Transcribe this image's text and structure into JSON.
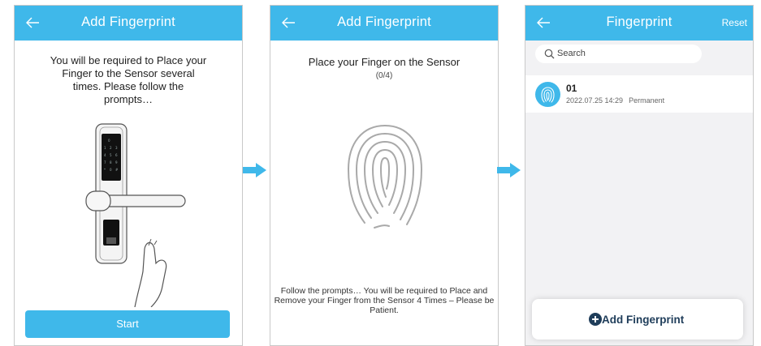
{
  "colors": {
    "accent": "#3fb8ea",
    "header_text": "#ffffff",
    "list_bg": "#f2f2f4",
    "add_label": "#1f3d5a"
  },
  "screen1": {
    "header_title": "Add Fingerprint",
    "back_icon": "arrow-left-icon",
    "instructions": "You will be required to Place your Finger to the Sensor several times. Please follow the prompts…",
    "image": "door-lock-with-finger-illustration",
    "start_label": "Start"
  },
  "screen2": {
    "header_title": "Add Fingerprint",
    "back_icon": "arrow-left-icon",
    "prompt": "Place your Finger on the Sensor",
    "progress": "(0/4)",
    "image": "fingerprint-icon",
    "footer": "Follow the prompts… You will be required to Place and Remove your Finger from the Sensor 4 Times – Please be Patient."
  },
  "screen3": {
    "header_title": "Fingerprint",
    "back_icon": "arrow-left-icon",
    "reset_label": "Reset",
    "search_placeholder": "Search",
    "entries": [
      {
        "name": "01",
        "date": "2022.07.25 14:29",
        "validity": "Permanent",
        "icon": "fingerprint-icon"
      }
    ],
    "add_label": "Add Fingerprint",
    "add_icon": "plus-circle-icon"
  },
  "flow_arrows": [
    "arrow-right-icon",
    "arrow-right-icon"
  ]
}
